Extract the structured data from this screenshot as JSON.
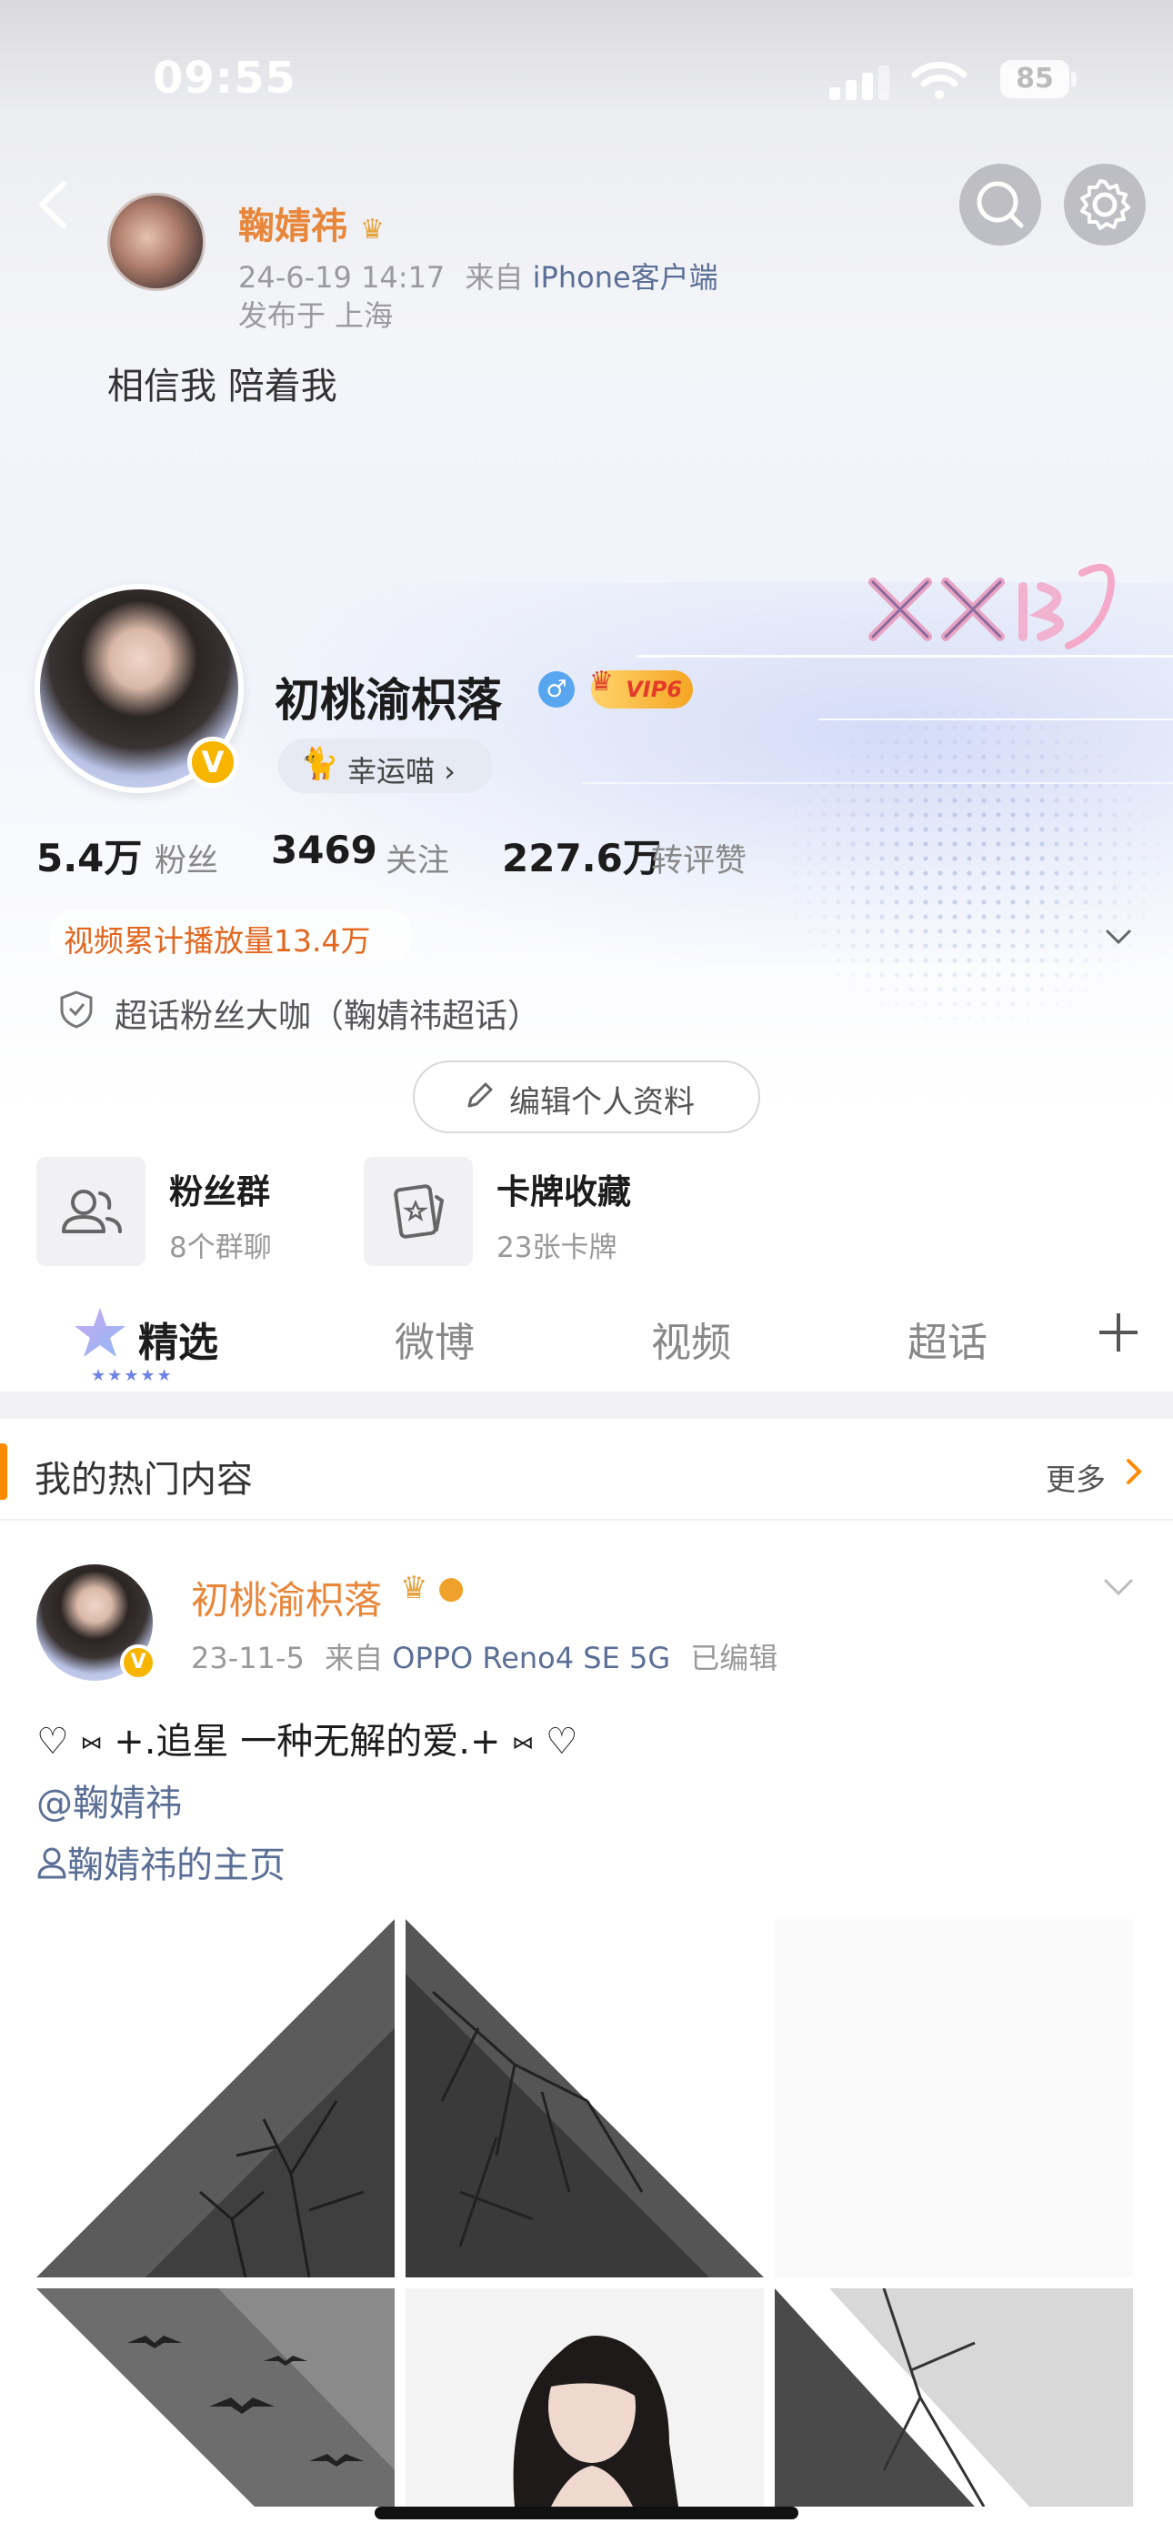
{
  "status_bar": {
    "time": "09:55",
    "battery": "85"
  },
  "pinned_post": {
    "author": "鞠婧祎",
    "time": "24-6-19 14:17",
    "from_prefix": "来自",
    "source": "iPhone客户端",
    "location": "发布于 上海",
    "text": "相信我 陪着我"
  },
  "profile": {
    "name": "初桃渝枳落",
    "vip_label": "VIP6",
    "lucky_label": "幸运喵 ›",
    "followers_num": "5.4万",
    "followers_label": "粉丝",
    "following_num": "3469",
    "following_label": "关注",
    "likes_num": "227.6万",
    "likes_label": "转评赞",
    "video_plays": "视频累计播放量13.4万",
    "supertopic": "超话粉丝大咖（鞠婧祎超话）",
    "edit_button": "编辑个人资料"
  },
  "tiles": [
    {
      "title": "粉丝群",
      "sub": "8个群聊"
    },
    {
      "title": "卡牌收藏",
      "sub": "23张卡牌"
    }
  ],
  "tabs": [
    "精选",
    "微博",
    "视频",
    "超话"
  ],
  "hot": {
    "title": "我的热门内容",
    "more": "更多"
  },
  "feed_post": {
    "author": "初桃渝枳落",
    "date": "23-11-5",
    "from_prefix": "来自",
    "source": "OPPO Reno4 SE 5G",
    "edited": "已编辑",
    "line1": "♡ ⑅ +.追星 一种无解的爱.+ ⑅ ♡",
    "mention": "@鞠婧祎",
    "homepage": "鞠婧祎的主页"
  },
  "colors": {
    "accent_orange": "#e8863a",
    "link_blue": "#5b6f96",
    "hot_bar": "#ff8a00"
  }
}
